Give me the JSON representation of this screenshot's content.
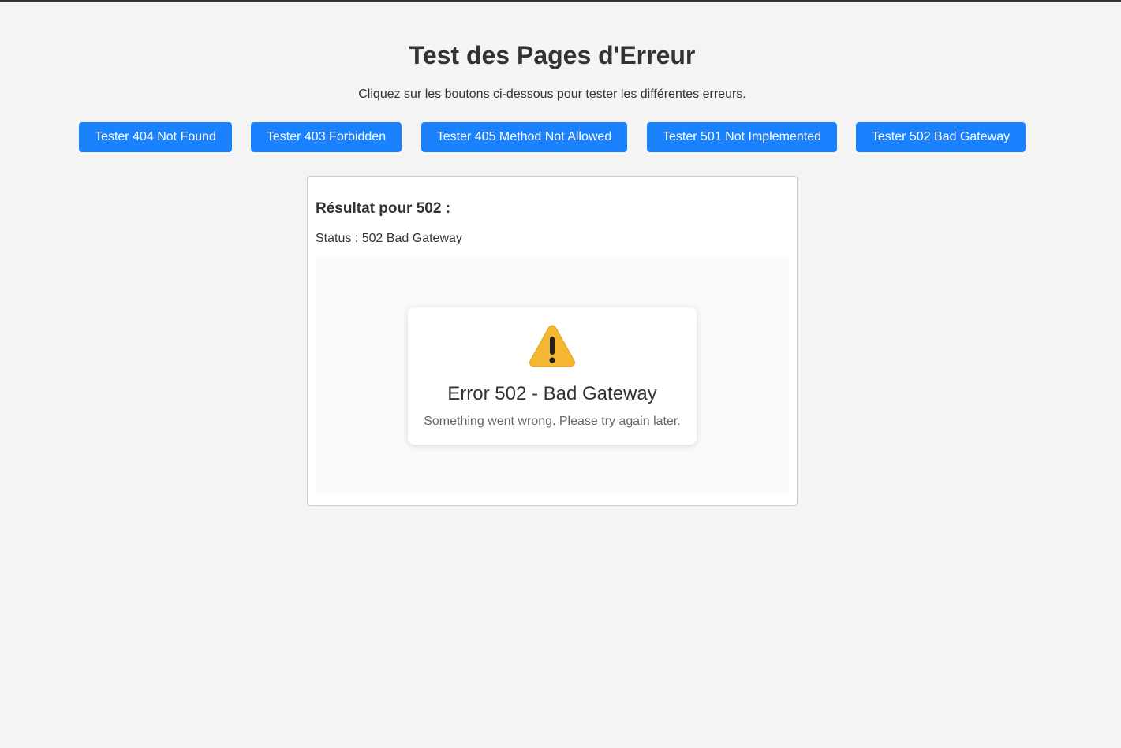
{
  "page": {
    "title": "Test des Pages d'Erreur",
    "subtitle": "Cliquez sur les boutons ci-dessous pour tester les différentes erreurs."
  },
  "buttons": [
    {
      "label": "Tester 404 Not Found"
    },
    {
      "label": "Tester 403 Forbidden"
    },
    {
      "label": "Tester 405 Method Not Allowed"
    },
    {
      "label": "Tester 501 Not Implemented"
    },
    {
      "label": "Tester 502 Bad Gateway"
    }
  ],
  "result": {
    "heading": "Résultat pour 502 :",
    "status": "Status : 502 Bad Gateway",
    "preview": {
      "icon": "warning-icon",
      "title": "Error 502 - Bad Gateway",
      "message": "Something went wrong. Please try again later."
    }
  },
  "colors": {
    "background": "#f4f4f4",
    "button": "#1a82ff",
    "button_text": "#ffffff",
    "text": "#333333",
    "muted_text": "#666666",
    "warning": "#f5b731"
  }
}
